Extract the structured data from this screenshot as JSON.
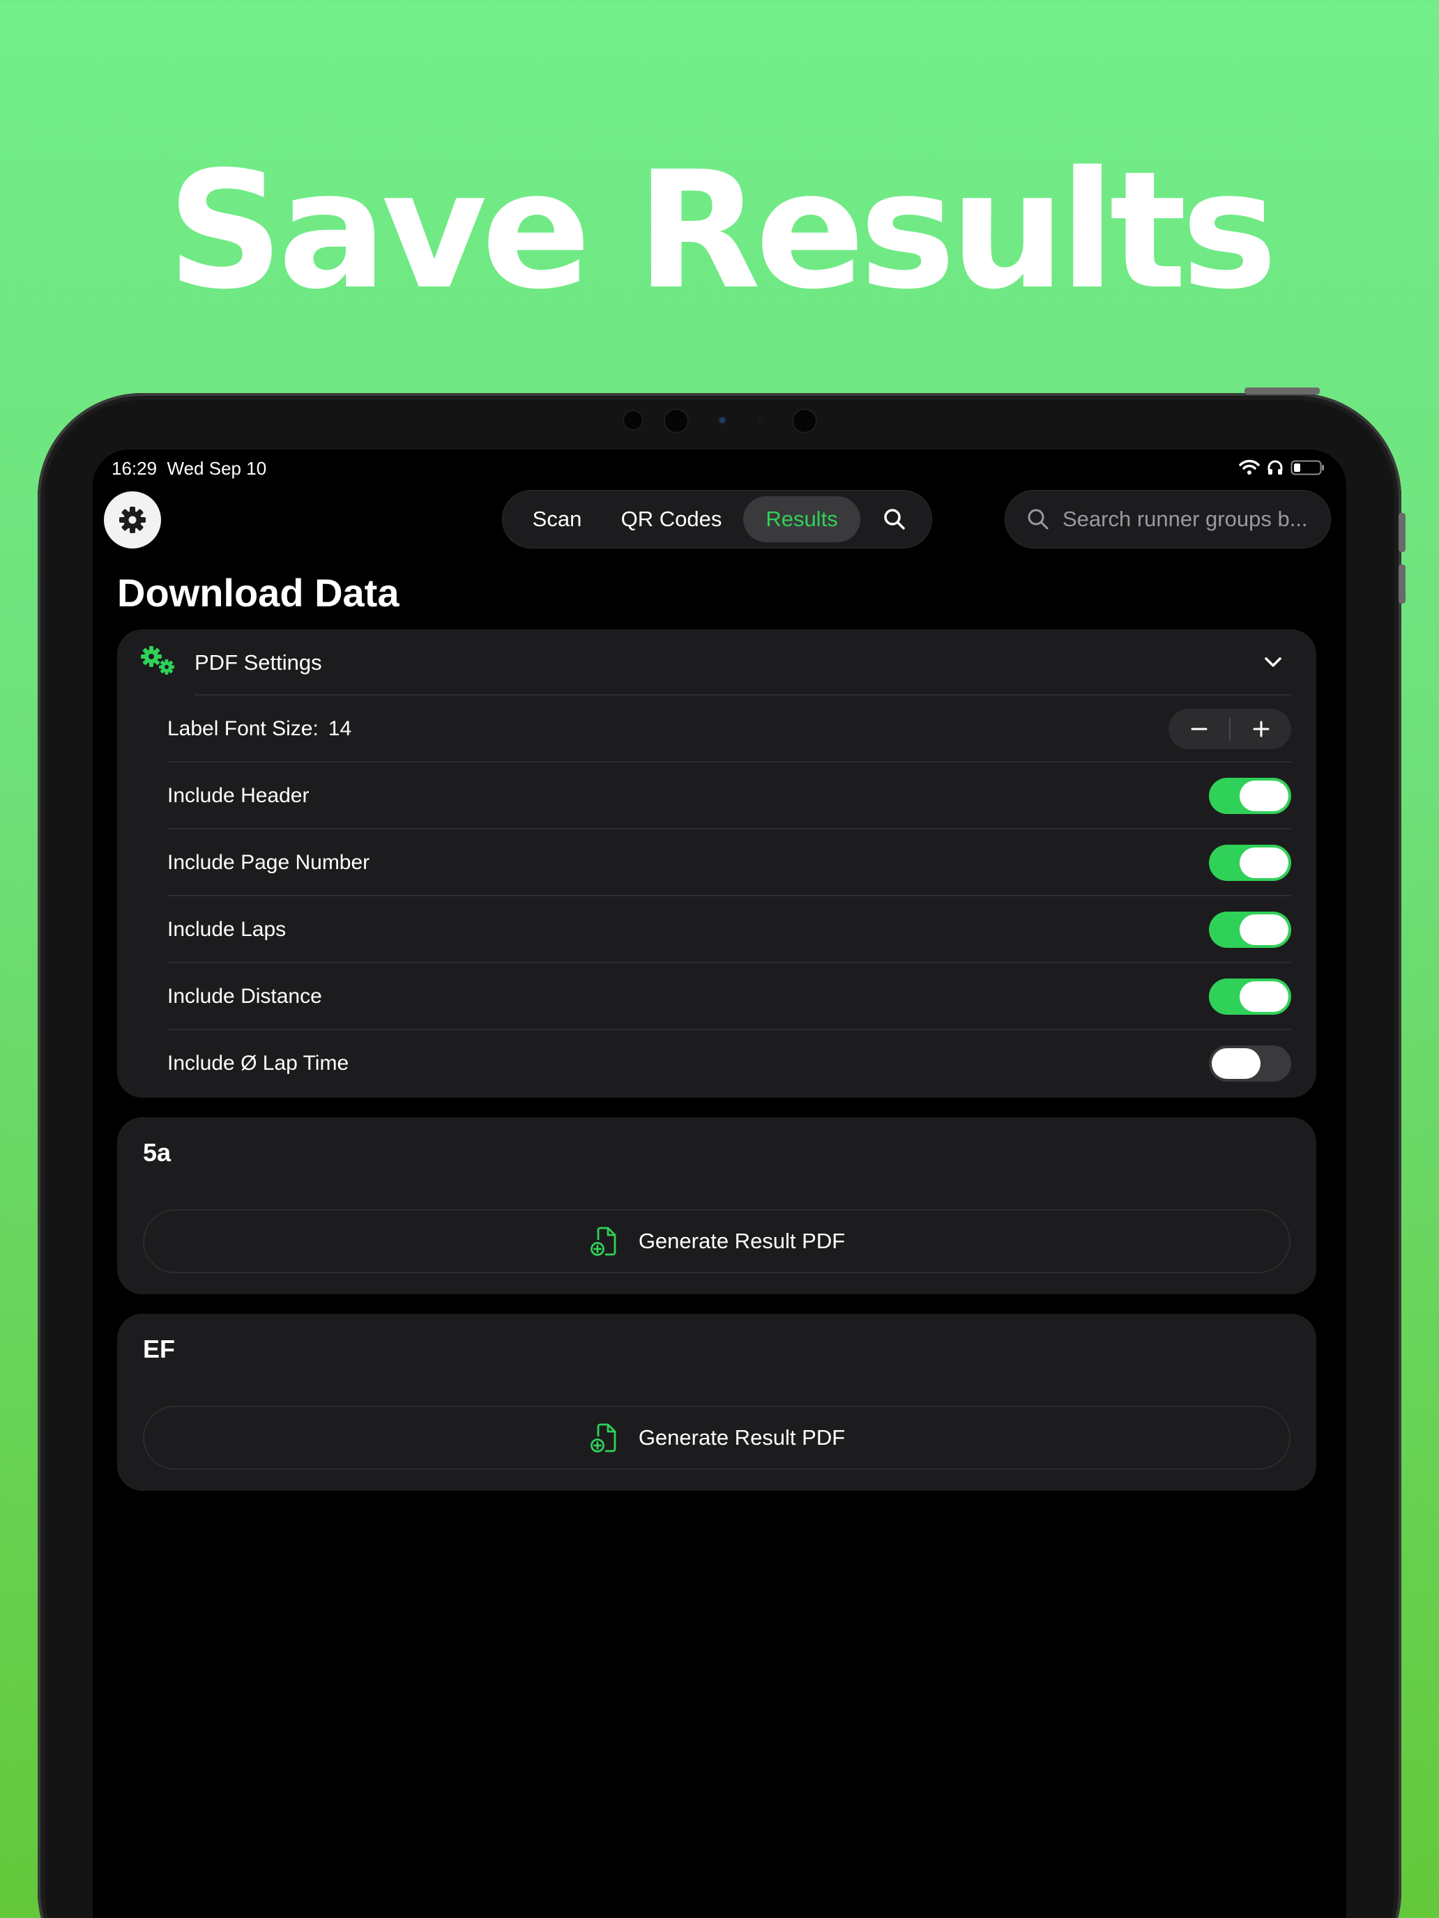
{
  "headline": "Save Results",
  "status_bar": {
    "time": "16:29",
    "date": "Wed Sep 10"
  },
  "nav": {
    "tabs": [
      {
        "label": "Scan",
        "active": false
      },
      {
        "label": "QR Codes",
        "active": false
      },
      {
        "label": "Results",
        "active": true
      }
    ],
    "search_placeholder": "Search runner groups b..."
  },
  "page_title": "Download Data",
  "pdf_settings": {
    "title": "PDF Settings",
    "font_size_label": "Label Font Size:",
    "font_size_value": "14",
    "options": [
      {
        "label": "Include Header",
        "enabled": true
      },
      {
        "label": "Include Page Number",
        "enabled": true
      },
      {
        "label": "Include Laps",
        "enabled": true
      },
      {
        "label": "Include Distance",
        "enabled": true
      },
      {
        "label": "Include Ø Lap Time",
        "enabled": false
      }
    ]
  },
  "groups": [
    {
      "name": "5a",
      "button_label": "Generate Result PDF"
    },
    {
      "name": "EF",
      "button_label": "Generate Result PDF"
    }
  ],
  "colors": {
    "accent": "#30d158",
    "card": "#1c1c1e",
    "background": "#000000",
    "toggle_off": "#3a3a3c"
  },
  "icons": [
    "gear-icon",
    "search-icon",
    "gears-icon",
    "chevron-down-icon",
    "minus-icon",
    "plus-icon",
    "document-add-icon",
    "wifi-icon",
    "headphones-icon",
    "battery-icon"
  ]
}
